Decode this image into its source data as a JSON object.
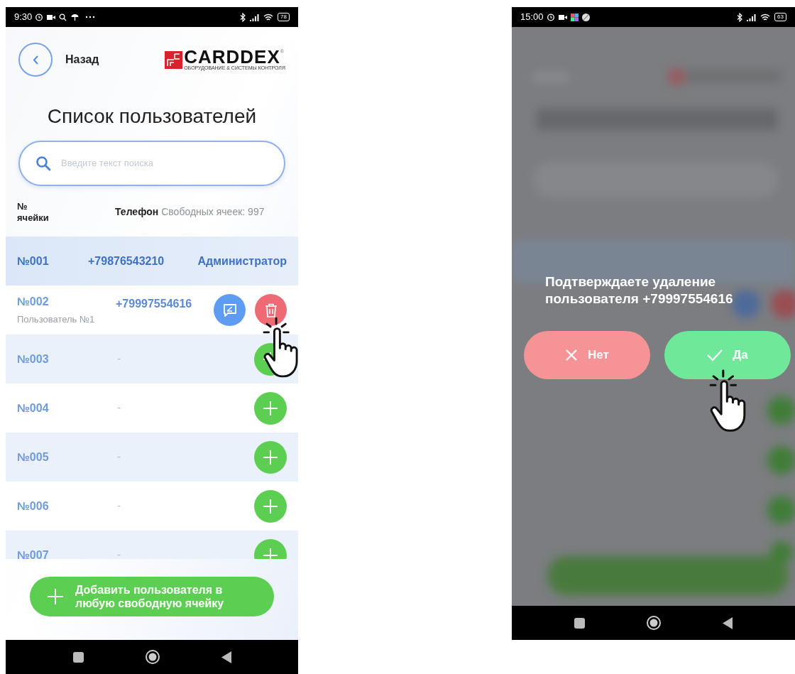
{
  "left_screen": {
    "status_bar": {
      "time": "9:30",
      "battery": "78"
    },
    "header": {
      "back_label": "Назад",
      "logo": {
        "name": "CARDDEX",
        "mark": "®",
        "tagline": "ОБОРУДОВАНИЕ & СИСТЕМЫ КОНТРОЛЯ"
      }
    },
    "title": "Список пользователей",
    "search": {
      "placeholder": "Введите текст поиска"
    },
    "columns": {
      "cell": "№ ячейки",
      "phone": "Телефон",
      "free_cells": "Свободных ячеек: 997"
    },
    "rows": [
      {
        "kind": "admin",
        "cell": "№001",
        "phone": "+79876543210",
        "role": "Администратор"
      },
      {
        "kind": "user",
        "cell": "№002",
        "phone": "+79997554616",
        "name": "Пользователь №1"
      },
      {
        "kind": "empty",
        "cell": "№003",
        "phone": "-"
      },
      {
        "kind": "empty",
        "cell": "№004",
        "phone": "-"
      },
      {
        "kind": "empty",
        "cell": "№005",
        "phone": "-"
      },
      {
        "kind": "empty",
        "cell": "№006",
        "phone": "-"
      },
      {
        "kind": "empty",
        "cell": "№007",
        "phone": "-"
      }
    ],
    "add_button": "Добавить пользователя в любую свободную ячейку"
  },
  "right_screen": {
    "status_bar": {
      "time": "15:00",
      "battery": "63"
    },
    "dialog": {
      "message": "Подтверждаете удаление пользователя +79997554616",
      "buttons": [
        {
          "kind": "cancel",
          "label": "Нет"
        },
        {
          "kind": "confirm",
          "label": "Да"
        }
      ]
    }
  }
}
